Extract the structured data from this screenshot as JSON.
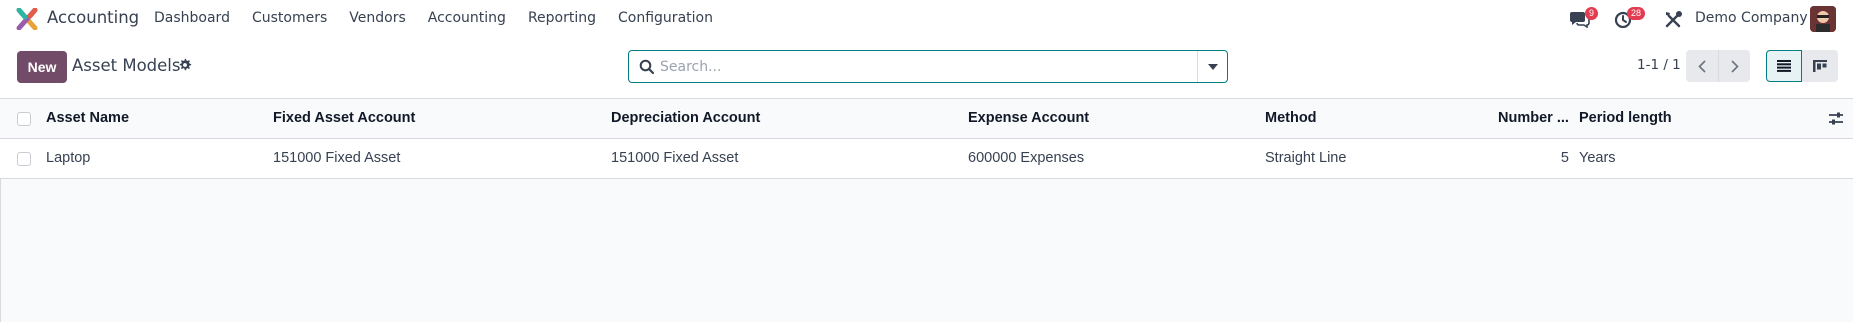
{
  "navbar": {
    "app_name": "Accounting",
    "menu": [
      "Dashboard",
      "Customers",
      "Vendors",
      "Accounting",
      "Reporting",
      "Configuration"
    ],
    "messages_badge": "9",
    "activities_badge": "28",
    "company": "Demo Company"
  },
  "control_panel": {
    "new_label": "New",
    "title": "Asset Models",
    "search_placeholder": "Search...",
    "pager": "1-1 / 1"
  },
  "table": {
    "headers": {
      "name": "Asset Name",
      "fixed": "Fixed Asset Account",
      "dep": "Depreciation Account",
      "exp": "Expense Account",
      "method": "Method",
      "number": "Number ...",
      "period": "Period length"
    },
    "rows": [
      {
        "name": "Laptop",
        "fixed": "151000 Fixed Asset",
        "dep": "151000 Fixed Asset",
        "exp": "600000 Expenses",
        "method": "Straight Line",
        "number": "5",
        "period": "Years"
      }
    ]
  },
  "colors": {
    "brand": "#714b67",
    "accent": "#017e84",
    "badge": "#e33b4f"
  },
  "icons": [
    "app-logo-icon",
    "chat-icon",
    "clock-icon",
    "tools-icon",
    "gear-icon",
    "search-icon",
    "caret-down-icon",
    "chevron-left-icon",
    "chevron-right-icon",
    "list-view-icon",
    "kanban-view-icon",
    "optional-columns-icon"
  ]
}
